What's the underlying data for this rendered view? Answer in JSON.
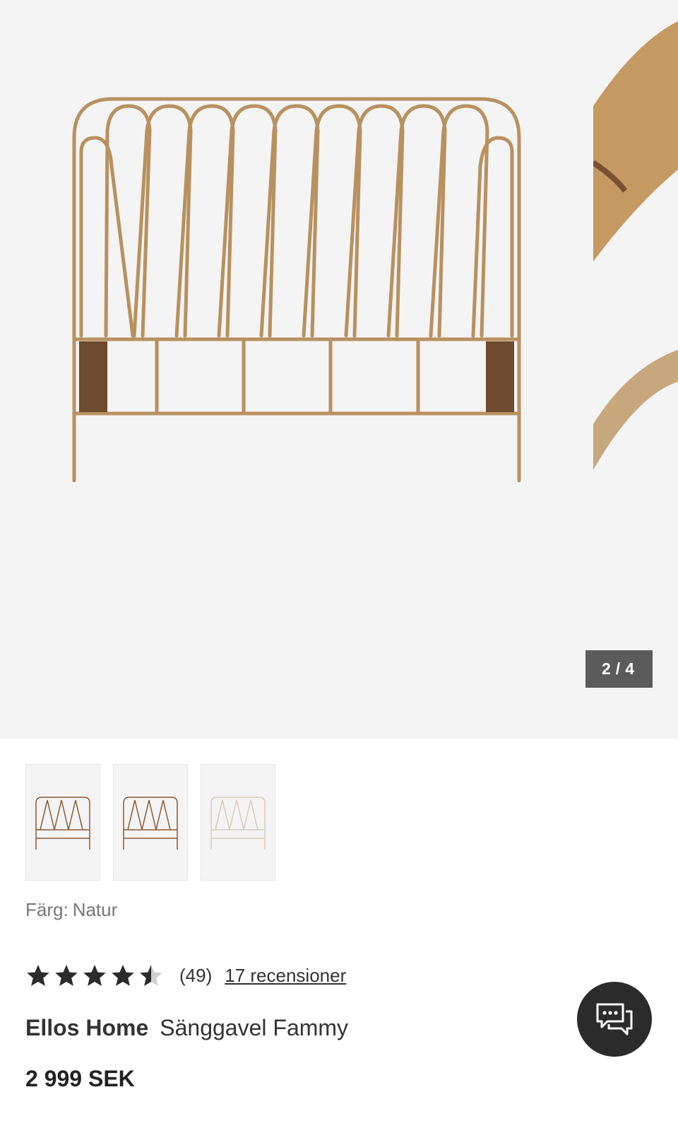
{
  "gallery": {
    "current": "2",
    "separator": "/",
    "total": "4",
    "main_image": "rattan-headboard",
    "peek_image": "rattan-closeup"
  },
  "thumbnails": [
    {
      "name": "headboard-natur-1",
      "color": "#8a5a34"
    },
    {
      "name": "headboard-natur-2",
      "color": "#8a5a34"
    },
    {
      "name": "headboard-white",
      "color": "#e8ddd0"
    }
  ],
  "color": {
    "label": "Färg:",
    "value": "Natur"
  },
  "rating": {
    "value": 4.5,
    "count": "(49)",
    "reviews_link": "17 recensioner"
  },
  "product": {
    "brand": "Ellos Home",
    "name": "Sänggavel Fammy",
    "price": "2 999 SEK"
  },
  "chat": {
    "icon": "chat-bubbles-icon"
  },
  "colors": {
    "accent": "#2b2b2b",
    "counter_bg": "#5b5b5b",
    "gallery_bg": "#f4f4f4"
  }
}
